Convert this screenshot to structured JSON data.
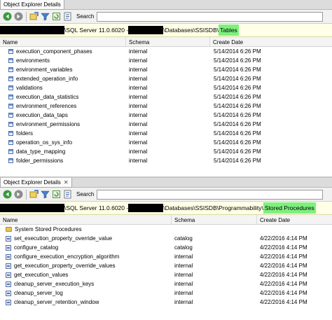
{
  "panel1": {
    "tab_label": "Object Explorer Details",
    "search_label": "Search",
    "search_value": "",
    "path": {
      "server_text": "\\SQL Server 11.0.6020 - ",
      "after_text": "\\Databases\\SSISDB\\",
      "highlight": "Tables"
    },
    "columns": [
      "Name",
      "Schema",
      "Create Date"
    ],
    "rows": [
      {
        "name": "execution_component_phases",
        "schema": "internal",
        "date": "5/14/2014 6:26 PM"
      },
      {
        "name": "environments",
        "schema": "internal",
        "date": "5/14/2014 6:26 PM"
      },
      {
        "name": "environment_variables",
        "schema": "internal",
        "date": "5/14/2014 6:26 PM"
      },
      {
        "name": "extended_operation_info",
        "schema": "internal",
        "date": "5/14/2014 6:26 PM"
      },
      {
        "name": "validations",
        "schema": "internal",
        "date": "5/14/2014 6:26 PM"
      },
      {
        "name": "execution_data_statistics",
        "schema": "internal",
        "date": "5/14/2014 6:26 PM"
      },
      {
        "name": "environment_references",
        "schema": "internal",
        "date": "5/14/2014 6:26 PM"
      },
      {
        "name": "execution_data_taps",
        "schema": "internal",
        "date": "5/14/2014 6:26 PM"
      },
      {
        "name": "environment_permissions",
        "schema": "internal",
        "date": "5/14/2014 6:26 PM"
      },
      {
        "name": "folders",
        "schema": "internal",
        "date": "5/14/2014 6:26 PM"
      },
      {
        "name": "operation_os_sys_info",
        "schema": "internal",
        "date": "5/14/2014 6:26 PM"
      },
      {
        "name": "data_type_mapping",
        "schema": "internal",
        "date": "5/14/2014 6:26 PM"
      },
      {
        "name": "folder_permissions",
        "schema": "internal",
        "date": "5/14/2014 6:26 PM"
      }
    ]
  },
  "panel2": {
    "tab_label": "Object Explorer Details",
    "search_label": "Search",
    "search_value": "",
    "path": {
      "server_text": "\\SQL Server 11.0.6020 - ",
      "after_text": "\\Databases\\SSISDB\\Programmability\\",
      "highlight": "Stored Procedures"
    },
    "columns": [
      "Name",
      "Schema",
      "Create Date"
    ],
    "folder_row": "System Stored Procedures",
    "rows": [
      {
        "name": "set_execution_property_override_value",
        "schema": "catalog",
        "date": "4/22/2016 4:14 PM"
      },
      {
        "name": "configure_catalog",
        "schema": "catalog",
        "date": "4/22/2016 4:14 PM"
      },
      {
        "name": "configure_execution_encryption_algorithm",
        "schema": "internal",
        "date": "4/22/2016 4:14 PM"
      },
      {
        "name": "get_execution_property_override_values",
        "schema": "internal",
        "date": "4/22/2016 4:14 PM"
      },
      {
        "name": "get_execution_values",
        "schema": "internal",
        "date": "4/22/2016 4:14 PM"
      },
      {
        "name": "cleanup_server_execution_keys",
        "schema": "internal",
        "date": "4/22/2016 4:14 PM"
      },
      {
        "name": "cleanup_server_log",
        "schema": "internal",
        "date": "4/22/2016 4:14 PM"
      },
      {
        "name": "cleanup_server_retention_window",
        "schema": "internal",
        "date": "4/22/2016 4:14 PM"
      }
    ]
  },
  "icons": {
    "back": "back-arrow-icon",
    "forward": "forward-arrow-icon",
    "sync": "sync-icon",
    "filter": "filter-icon",
    "refresh": "refresh-icon",
    "script": "script-icon",
    "close": "close-icon",
    "table": "table-icon",
    "procedure": "stored-procedure-icon",
    "folder": "folder-icon"
  },
  "colors": {
    "path_bar": "#ffffe7",
    "highlight": "#7ef07e",
    "redaction": "#000000"
  }
}
